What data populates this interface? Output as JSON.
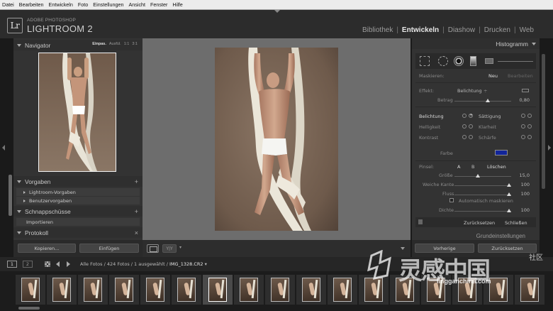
{
  "menu": [
    "Datei",
    "Bearbeiten",
    "Entwickeln",
    "Foto",
    "Einstellungen",
    "Ansicht",
    "Fenster",
    "Hilfe"
  ],
  "app": {
    "logo": "Lr",
    "brand_top": "ADOBE PHOTOSHOP",
    "brand_main": "LIGHTROOM 2"
  },
  "modules": [
    {
      "label": "Bibliothek",
      "active": false
    },
    {
      "label": "Entwickeln",
      "active": true
    },
    {
      "label": "Diashow",
      "active": false
    },
    {
      "label": "Drucken",
      "active": false
    },
    {
      "label": "Web",
      "active": false
    }
  ],
  "module_separator": "|",
  "left": {
    "navigator": {
      "title": "Navigator",
      "options": [
        "Einpas.",
        "Ausfül.",
        "1:1",
        "3:1"
      ]
    },
    "presets": {
      "title": "Vorgaben",
      "plus": "+",
      "items": [
        "Lightroom-Vorgaben",
        "Benutzervorgaben"
      ]
    },
    "snapshots": {
      "title": "Schnappschüsse",
      "plus": "+",
      "items": [
        "Importieren"
      ]
    },
    "history": {
      "title": "Protokoll",
      "close": "×"
    },
    "buttons": {
      "copy": "Kopieren...",
      "paste": "Einfügen"
    }
  },
  "toolbar": {
    "yy": "Y|Y",
    "yy_dropdown": "▾"
  },
  "right": {
    "histogram_title": "Histogramm",
    "mask": {
      "label": "Maskieren:",
      "new": "Neu",
      "edit": "Bearbeiten"
    },
    "effect": {
      "label": "Effekt:",
      "value": "Belichtung",
      "dropdown": "÷",
      "amount_label": "Betrag",
      "amount_value": "0,80"
    },
    "adjustments": [
      {
        "left": "Belichtung",
        "right": "Sättigung"
      },
      {
        "left": "Helligkeit",
        "right": "Klarheit"
      },
      {
        "left": "Kontrast",
        "right": "Schärfe"
      }
    ],
    "color_label": "Farbe",
    "color_value": "#12259a",
    "brush": {
      "label": "Pinsel:",
      "a": "A",
      "b": "B",
      "clear": "Löschen",
      "size_label": "Größe",
      "size_value": "15,0",
      "feather_label": "Weiche Kante",
      "feather_value": "100",
      "flow_label": "Fluss",
      "flow_value": "100",
      "automask_label": "Automatisch maskieren",
      "density_label": "Dichte",
      "density_value": "100"
    },
    "reset_label": "Zurücksetzen",
    "close_label": "Schließen",
    "basic_title": "Grundeinstellungen",
    "buttons": {
      "previous": "Vorherige",
      "reset": "Zurücksetzen"
    }
  },
  "filmbar": {
    "view1": "1",
    "view2": "2",
    "path_prefix": "Alle Fotos / 424 Fotos / 1 ausgewählt / ",
    "path_file": "IMG_1328.CR2",
    "path_dropdown": "▾"
  },
  "filmstrip": {
    "count": 17,
    "selected_index": 6
  },
  "watermark": {
    "main": "灵感中国",
    "she": "社区",
    "url": "lingganchina.com"
  },
  "colors": {
    "panel": "#333333",
    "center": "#6d6d6d",
    "accent_blue": "#12259a"
  }
}
